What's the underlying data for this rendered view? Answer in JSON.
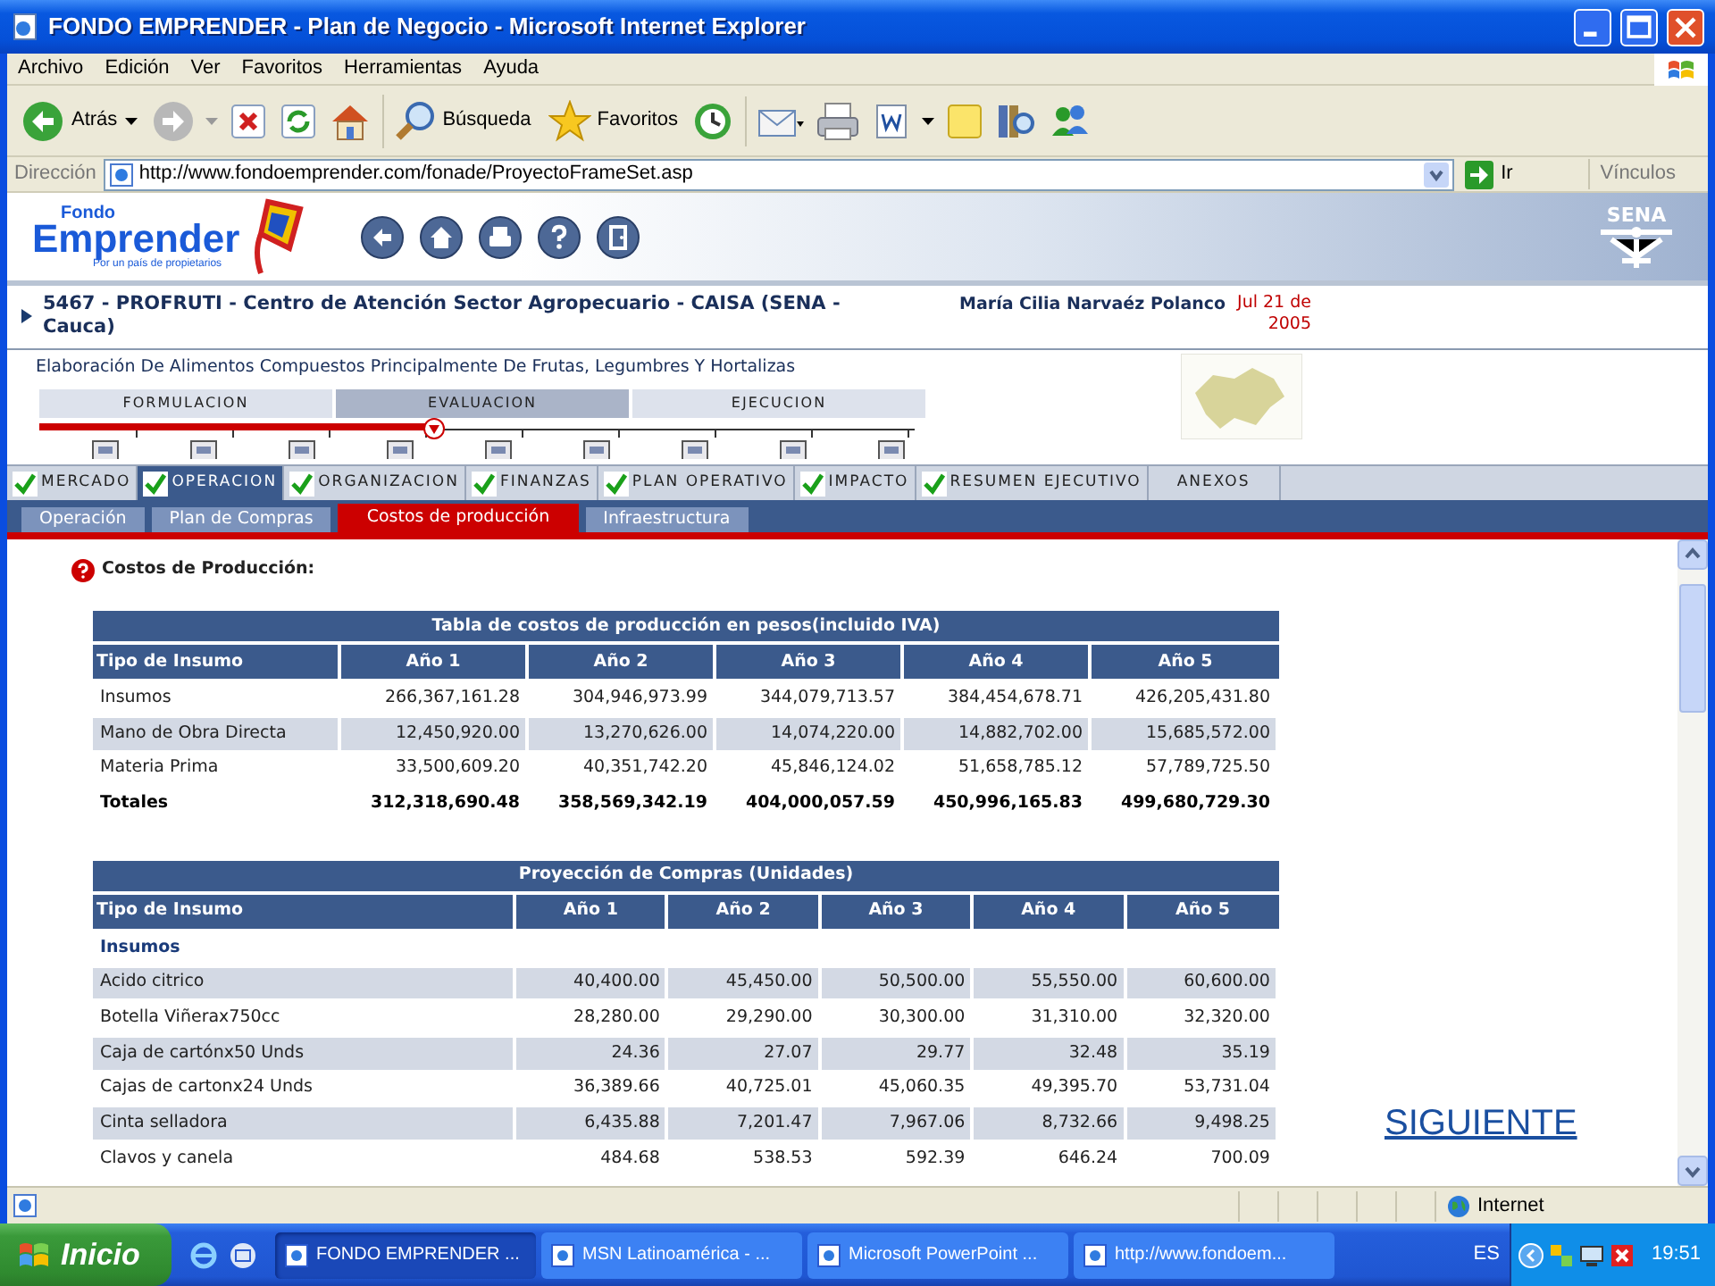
{
  "window": {
    "title": "FONDO EMPRENDER - Plan de Negocio - Microsoft Internet Explorer"
  },
  "menu": [
    "Archivo",
    "Edición",
    "Ver",
    "Favoritos",
    "Herramientas",
    "Ayuda"
  ],
  "toolbar": {
    "back": "Atrás",
    "search": "Búsqueda",
    "favorites": "Favoritos"
  },
  "address_bar": {
    "label": "Dirección",
    "url": "http://www.fondoemprender.com/fonade/ProyectoFrameSet.asp",
    "go": "Ir",
    "links": "Vínculos"
  },
  "header": {
    "logo_top": "Fondo",
    "logo_main": "Emprender",
    "logo_tagline": "Por un país de propietarios",
    "sena": "SENA"
  },
  "project": {
    "title": "5467 - PROFRUTI - Centro de Atención Sector Agropecuario - CAISA (SENA - Cauca)",
    "user": "María Cilia Narvaéz Polanco",
    "date": "Jul 21 de 2005",
    "subtitle": "Elaboración De Alimentos Compuestos Principalmente De Frutas, Legumbres Y Hortalizas"
  },
  "phases": [
    {
      "label": "FORMULACION",
      "selected": false
    },
    {
      "label": "EVALUACION",
      "selected": true
    },
    {
      "label": "EJECUCION",
      "selected": false
    }
  ],
  "progress": {
    "level": 0.45
  },
  "modules": [
    {
      "label": "MERCADO",
      "checked": true,
      "selected": false
    },
    {
      "label": "OPERACION",
      "checked": true,
      "selected": true
    },
    {
      "label": "ORGANIZACION",
      "checked": true,
      "selected": false
    },
    {
      "label": "FINANZAS",
      "checked": true,
      "selected": false
    },
    {
      "label": "PLAN OPERATIVO",
      "checked": true,
      "selected": false
    },
    {
      "label": "IMPACTO",
      "checked": true,
      "selected": false
    },
    {
      "label": "RESUMEN EJECUTIVO",
      "checked": true,
      "selected": false
    },
    {
      "label": "ANEXOS",
      "checked": false,
      "selected": false
    }
  ],
  "subtabs": [
    {
      "label": "Operación",
      "selected": false
    },
    {
      "label": "Plan de Compras",
      "selected": false
    },
    {
      "label": "Costos de producción",
      "selected": true
    },
    {
      "label": "Infraestructura",
      "selected": false
    }
  ],
  "section_title": "Costos de Producción:",
  "cost_table": {
    "title": "Tabla de costos de producción en pesos(incluido IVA)",
    "columns": [
      "Tipo de Insumo",
      "Año 1",
      "Año 2",
      "Año 3",
      "Año 4",
      "Año 5"
    ],
    "rows": [
      {
        "kind": "data",
        "cells": [
          "Insumos",
          "266,367,161.28",
          "304,946,973.99",
          "344,079,713.57",
          "384,454,678.71",
          "426,205,431.80"
        ]
      },
      {
        "kind": "data",
        "cells": [
          "Mano de Obra Directa",
          "12,450,920.00",
          "13,270,626.00",
          "14,074,220.00",
          "14,882,702.00",
          "15,685,572.00"
        ]
      },
      {
        "kind": "data",
        "cells": [
          "Materia Prima",
          "33,500,609.20",
          "40,351,742.20",
          "45,846,124.02",
          "51,658,785.12",
          "57,789,725.50"
        ]
      },
      {
        "kind": "total",
        "cells": [
          "Totales",
          "312,318,690.48",
          "358,569,342.19",
          "404,000,057.59",
          "450,996,165.83",
          "499,680,729.30"
        ]
      }
    ]
  },
  "purchases_table": {
    "title": "Proyección de Compras (Unidades)",
    "columns": [
      "Tipo de Insumo",
      "Año 1",
      "Año 2",
      "Año 3",
      "Año 4",
      "Año 5"
    ],
    "rows": [
      {
        "kind": "group",
        "cells": [
          "Insumos"
        ]
      },
      {
        "kind": "data",
        "cells": [
          "Acido citrico",
          "40,400.00",
          "45,450.00",
          "50,500.00",
          "55,550.00",
          "60,600.00"
        ]
      },
      {
        "kind": "data",
        "cells": [
          "Botella Viñerax750cc",
          "28,280.00",
          "29,290.00",
          "30,300.00",
          "31,310.00",
          "32,320.00"
        ]
      },
      {
        "kind": "data",
        "cells": [
          "Caja de cartónx50 Unds",
          "24.36",
          "27.07",
          "29.77",
          "32.48",
          "35.19"
        ]
      },
      {
        "kind": "data",
        "cells": [
          "Cajas de cartonx24 Unds",
          "36,389.66",
          "40,725.01",
          "45,060.35",
          "49,395.70",
          "53,731.04"
        ]
      },
      {
        "kind": "data",
        "cells": [
          "Cinta selladora",
          "6,435.88",
          "7,201.47",
          "7,967.06",
          "8,732.66",
          "9,498.25"
        ]
      },
      {
        "kind": "data",
        "cells": [
          "Clavos y canela",
          "484.68",
          "538.53",
          "592.39",
          "646.24",
          "700.09"
        ]
      }
    ]
  },
  "next_link": "SIGUIENTE",
  "status_bar": {
    "zone": "Internet"
  },
  "taskbar": {
    "start": "Inicio",
    "tasks": [
      {
        "label": "FONDO EMPRENDER ...",
        "selected": true
      },
      {
        "label": "MSN Latinoamérica - ...",
        "selected": false
      },
      {
        "label": "Microsoft PowerPoint ...",
        "selected": false
      },
      {
        "label": "http://www.fondoem...",
        "selected": false
      }
    ],
    "language": "ES",
    "clock": "19:51"
  }
}
